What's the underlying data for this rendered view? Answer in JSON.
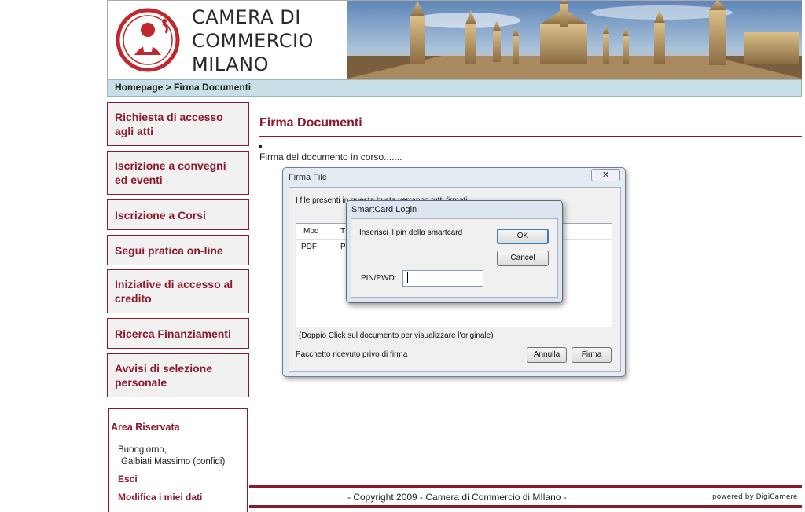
{
  "header": {
    "logo_lines": [
      "CAMERA DI",
      "COMMERCIO",
      "MILANO"
    ],
    "breadcrumb": "Homepage > Firma Documenti"
  },
  "sidebar": {
    "items": [
      {
        "label": "Richiesta di accesso agli atti"
      },
      {
        "label": "Iscrizione a convegni ed eventi"
      },
      {
        "label": "Iscrizione a Corsi"
      },
      {
        "label": "Segui pratica on-line"
      },
      {
        "label": "Iniziative di accesso al credito"
      },
      {
        "label": "Ricerca Finanziamenti"
      },
      {
        "label": "Avvisi di selezione personale"
      }
    ],
    "reserved": {
      "title": "Area Riservata",
      "greeting_line1": "Buongiorno,",
      "greeting_line2": "Galbiati Massimo (confidi)",
      "logout": "Esci",
      "edit_profile": "Modifica i miei dati"
    }
  },
  "main": {
    "title": "Firma Documenti",
    "status": "Firma del documento in corso......."
  },
  "firma_dialog": {
    "title": "Firma File",
    "close": "✕",
    "info": "I file presenti in questa busta verranno tutti firmati",
    "columns": [
      "Mod",
      "T"
    ],
    "rows": [
      {
        "mod": "PDF",
        "t": "P"
      }
    ],
    "hint": "(Doppio Click sul documento per visualizzare l'originale)",
    "package_status": "Pacchetto ricevuto privo di firma",
    "cancel_label": "Annulla",
    "sign_label": "Firma"
  },
  "smartcard_dialog": {
    "title": "SmartCard Login",
    "prompt": "Inserisci il pin della smartcard",
    "ok_label": "OK",
    "cancel_label": "Cancel",
    "pin_label": "PIN/PWD:",
    "pin_value": ""
  },
  "footer": {
    "copyright": "- Copyright 2009 - Camera di Commercio di MIlano -",
    "powered_by": "powered by DigiCamere"
  },
  "colors": {
    "brand": "#8b1a2b",
    "breadcrumb_bg": "#c7dfe6",
    "dialog_frame": "#dde6f0"
  }
}
